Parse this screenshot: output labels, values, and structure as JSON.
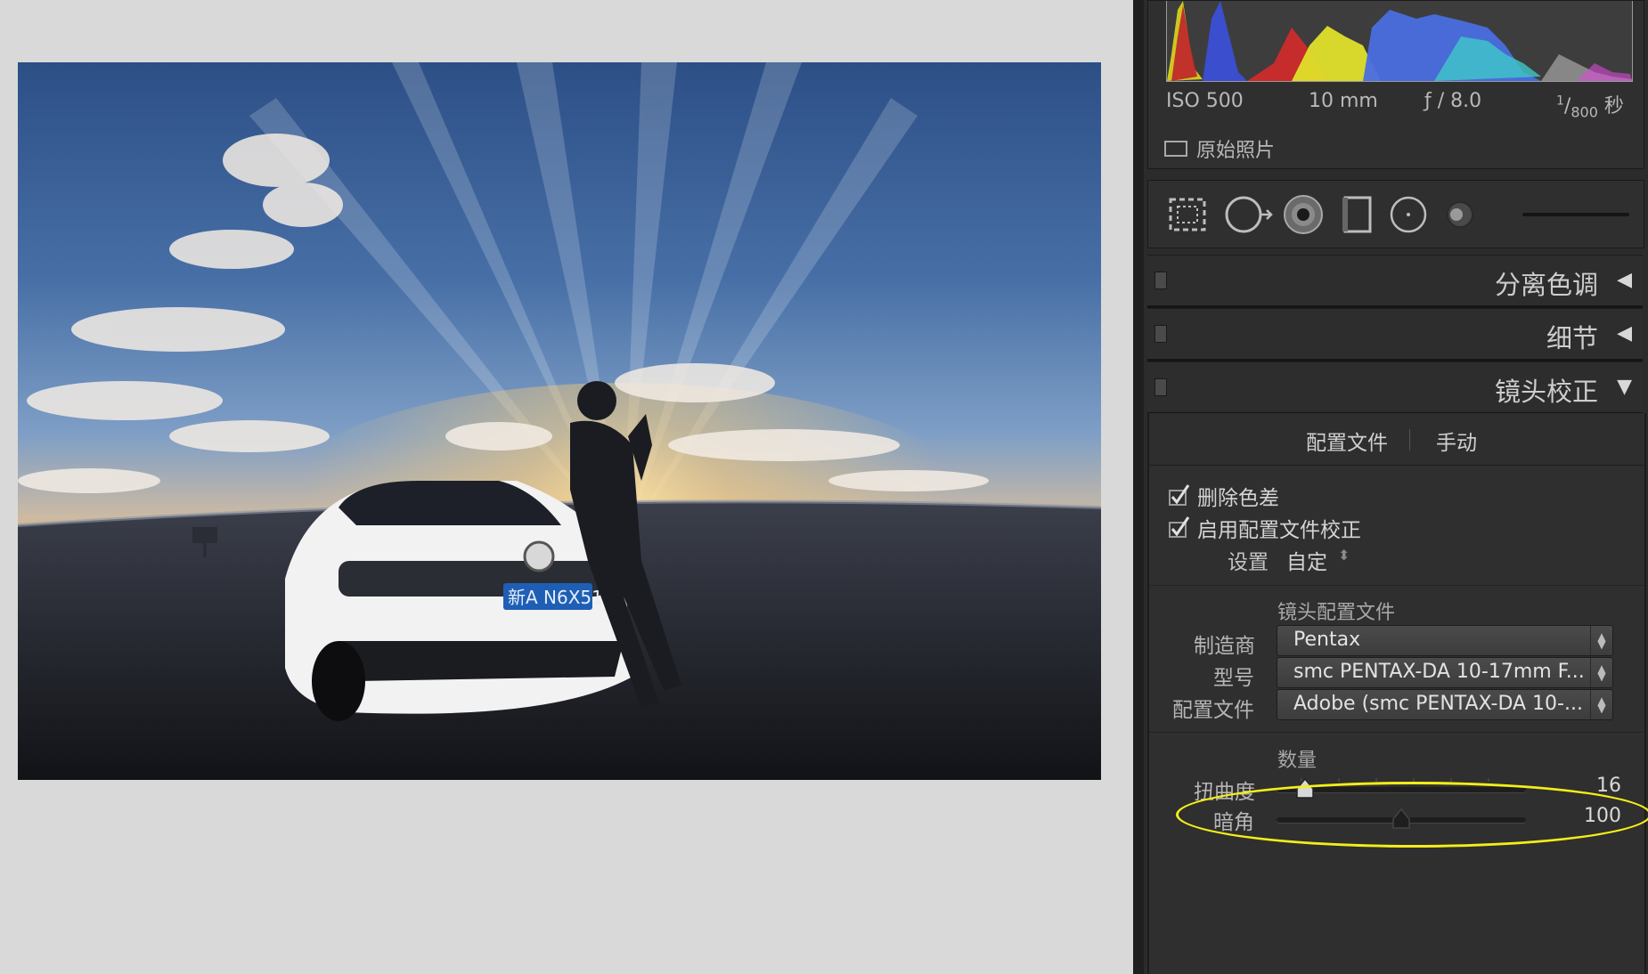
{
  "histogram": {
    "exif": {
      "iso": "ISO 500",
      "focal": "10 mm",
      "aperture": "ƒ / 8.0",
      "shutter_num": "1",
      "shutter_den": "800",
      "shutter_unit": "秒"
    },
    "original_photo_label": "原始照片"
  },
  "tools": {
    "icons": [
      "crop-overlay-icon",
      "spot-removal-icon",
      "red-eye-icon",
      "graduated-filter-icon",
      "radial-filter-icon",
      "adjustment-brush-icon"
    ]
  },
  "sections": {
    "split_toning": {
      "title": "分离色调",
      "arrow": "◀"
    },
    "detail": {
      "title": "细节",
      "arrow": "◀"
    },
    "lens_correction": {
      "title": "镜头校正",
      "arrow": "▼"
    }
  },
  "lens": {
    "tabs": [
      "配置文件",
      "手动"
    ],
    "remove_ca_label": "删除色差",
    "enable_profile_label": "启用配置文件校正",
    "setup_label": "设置",
    "setup_value": "自定",
    "setup_arrows": "⬍",
    "profile_heading": "镜头配置文件",
    "make_label": "制造商",
    "make_value": "Pentax",
    "model_label": "型号",
    "model_value": "smc PENTAX-DA 10-17mm F...",
    "profile_label": "配置文件",
    "profile_value": "Adobe (smc PENTAX-DA 10-...",
    "amount_heading": "数量",
    "distortion_label": "扭曲度",
    "distortion_value": "16",
    "vignetting_label": "暗角",
    "vignetting_value": "100"
  },
  "photo": {
    "plate_text": "新A N6X51"
  },
  "colors": {
    "highlight": "#f4ee19",
    "panel_bg": "#2b2b2b",
    "canvas_bg": "#d9d9d9"
  }
}
